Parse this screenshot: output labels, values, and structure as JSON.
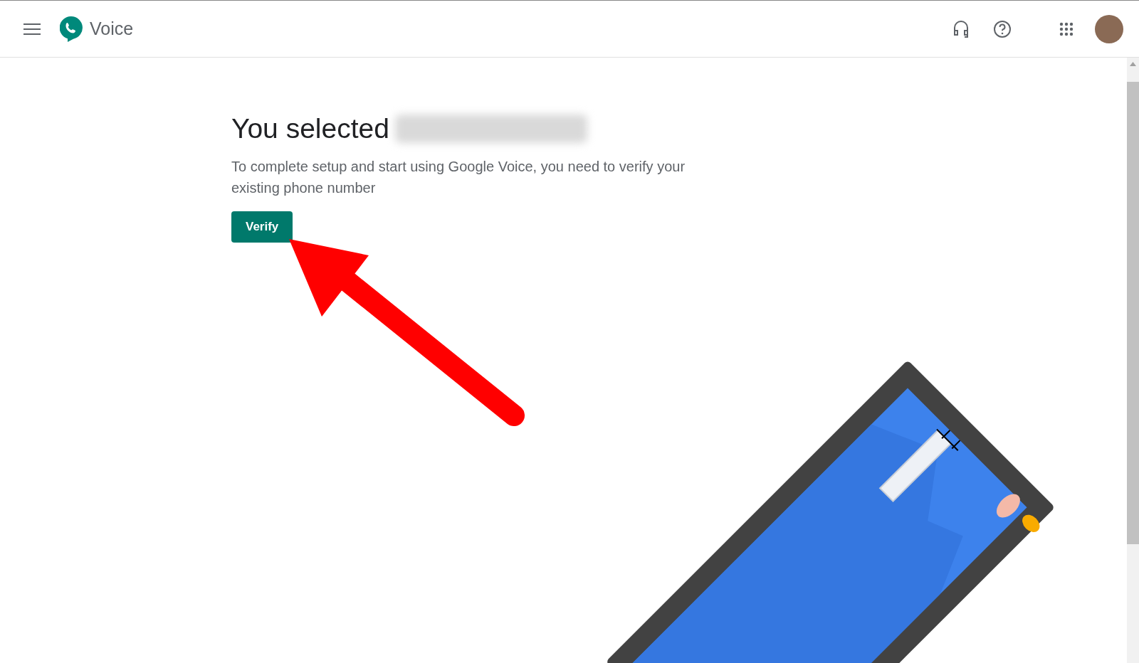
{
  "app_bar": {
    "app_name": "Voice"
  },
  "main": {
    "heading": "You selected",
    "description": "To complete setup and start using Google Voice, you need to verify your existing phone number",
    "button": "Verify"
  }
}
